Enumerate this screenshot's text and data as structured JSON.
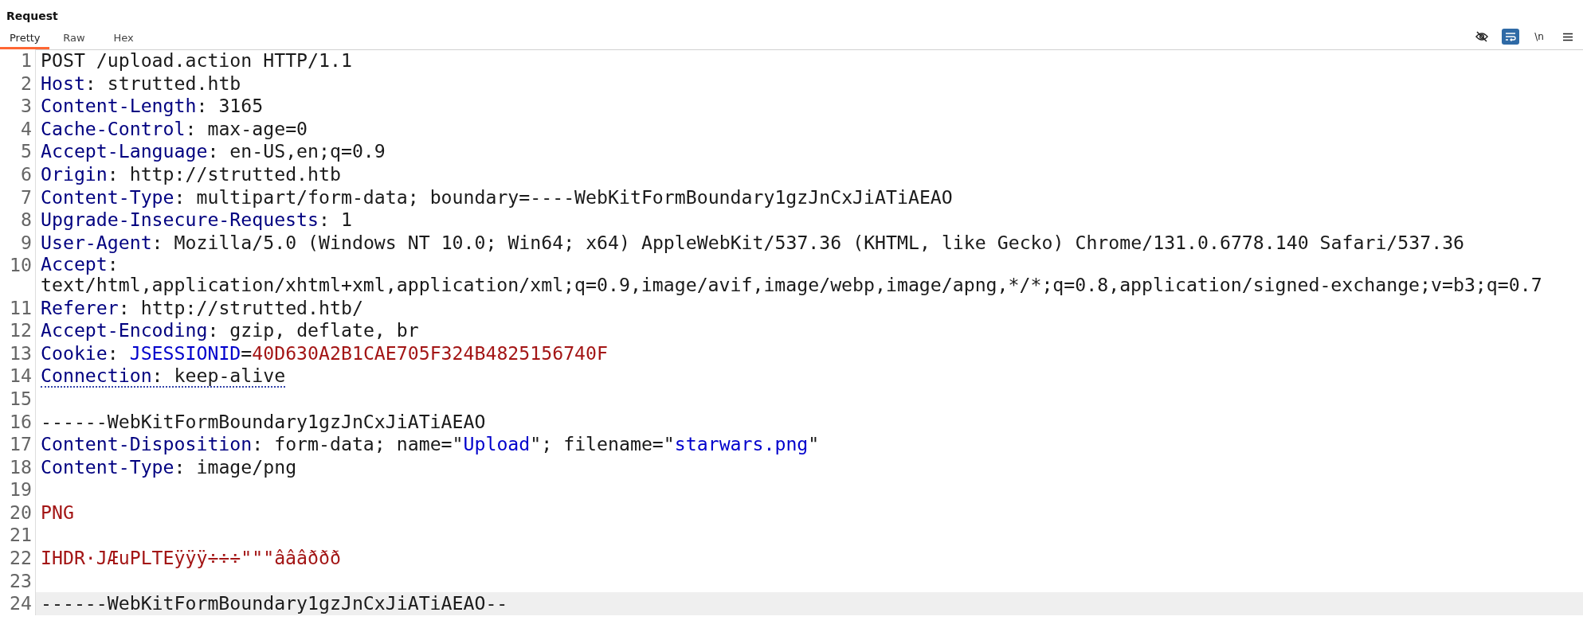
{
  "panel": {
    "title": "Request"
  },
  "tabs": [
    {
      "label": "Pretty",
      "selected": true
    },
    {
      "label": "Raw",
      "selected": false
    },
    {
      "label": "Hex",
      "selected": false
    }
  ],
  "toolbar": [
    {
      "kind": "eye",
      "on": false
    },
    {
      "kind": "wrap",
      "on": true
    },
    {
      "kind": "newline",
      "label": "\\n",
      "on": false
    },
    {
      "kind": "menu",
      "on": false
    }
  ],
  "lines": [
    {
      "number": "1",
      "selected": false,
      "underlined": false,
      "segments": [
        {
          "kind": "plain",
          "text": "POST /upload.action HTTP/1.1"
        }
      ]
    },
    {
      "number": "2",
      "selected": false,
      "underlined": false,
      "segments": [
        {
          "kind": "key",
          "text": "Host"
        },
        {
          "kind": "plain",
          "text": ": strutted.htb"
        }
      ]
    },
    {
      "number": "3",
      "selected": false,
      "underlined": false,
      "segments": [
        {
          "kind": "key",
          "text": "Content-Length"
        },
        {
          "kind": "plain",
          "text": ": 3165"
        }
      ]
    },
    {
      "number": "4",
      "selected": false,
      "underlined": false,
      "segments": [
        {
          "kind": "key",
          "text": "Cache-Control"
        },
        {
          "kind": "plain",
          "text": ": max-age=0"
        }
      ]
    },
    {
      "number": "5",
      "selected": false,
      "underlined": false,
      "segments": [
        {
          "kind": "key",
          "text": "Accept-Language"
        },
        {
          "kind": "plain",
          "text": ": en-US,en;q=0.9"
        }
      ]
    },
    {
      "number": "6",
      "selected": false,
      "underlined": false,
      "segments": [
        {
          "kind": "key",
          "text": "Origin"
        },
        {
          "kind": "plain",
          "text": ": http://strutted.htb"
        }
      ]
    },
    {
      "number": "7",
      "selected": false,
      "underlined": false,
      "segments": [
        {
          "kind": "key",
          "text": "Content-Type"
        },
        {
          "kind": "plain",
          "text": ": multipart/form-data; boundary=----WebKitFormBoundary1gzJnCxJiATiAEAO"
        }
      ]
    },
    {
      "number": "8",
      "selected": false,
      "underlined": false,
      "segments": [
        {
          "kind": "key",
          "text": "Upgrade-Insecure-Requests"
        },
        {
          "kind": "plain",
          "text": ": 1"
        }
      ]
    },
    {
      "number": "9",
      "selected": false,
      "underlined": false,
      "segments": [
        {
          "kind": "key",
          "text": "User-Agent"
        },
        {
          "kind": "plain",
          "text": ": Mozilla/5.0 (Windows NT 10.0; Win64; x64) AppleWebKit/537.36 (KHTML, like Gecko) Chrome/131.0.6778.140 Safari/537.36"
        }
      ]
    },
    {
      "number": "10",
      "selected": false,
      "underlined": false,
      "segments": [
        {
          "kind": "key",
          "text": "Accept"
        },
        {
          "kind": "plain",
          "text": ": text/html,application/xhtml+xml,application/xml;q=0.9,image/avif,image/webp,image/apng,*/*;q=0.8,application/signed-exchange;v=b3;q=0.7"
        }
      ]
    },
    {
      "number": "11",
      "selected": false,
      "underlined": false,
      "segments": [
        {
          "kind": "key",
          "text": "Referer"
        },
        {
          "kind": "plain",
          "text": ": http://strutted.htb/"
        }
      ]
    },
    {
      "number": "12",
      "selected": false,
      "underlined": false,
      "segments": [
        {
          "kind": "key",
          "text": "Accept-Encoding"
        },
        {
          "kind": "plain",
          "text": ": gzip, deflate, br"
        }
      ]
    },
    {
      "number": "13",
      "selected": false,
      "underlined": false,
      "segments": [
        {
          "kind": "key",
          "text": "Cookie"
        },
        {
          "kind": "plain",
          "text": ": "
        },
        {
          "kind": "attr",
          "text": "JSESSIONID"
        },
        {
          "kind": "plain",
          "text": "="
        },
        {
          "kind": "value",
          "text": "40D630A2B1CAE705F324B4825156740F"
        }
      ]
    },
    {
      "number": "14",
      "selected": false,
      "underlined": true,
      "segments": [
        {
          "kind": "key",
          "text": "Connection"
        },
        {
          "kind": "plain",
          "text": ": keep-alive"
        }
      ]
    },
    {
      "number": "15",
      "selected": false,
      "underlined": false
    },
    {
      "number": "16",
      "selected": false,
      "underlined": false,
      "segments": [
        {
          "kind": "plain",
          "text": "------WebKitFormBoundary1gzJnCxJiATiAEAO"
        }
      ]
    },
    {
      "number": "17",
      "selected": false,
      "underlined": false,
      "segments": [
        {
          "kind": "key",
          "text": "Content-Disposition"
        },
        {
          "kind": "plain",
          "text": ": form-data; name=\""
        },
        {
          "kind": "attr",
          "text": "Upload"
        },
        {
          "kind": "plain",
          "text": "\"; filename=\""
        },
        {
          "kind": "attr",
          "text": "starwars.png"
        },
        {
          "kind": "plain",
          "text": "\""
        }
      ]
    },
    {
      "number": "18",
      "selected": false,
      "underlined": false,
      "segments": [
        {
          "kind": "key",
          "text": "Content-Type"
        },
        {
          "kind": "plain",
          "text": ": image/png"
        }
      ]
    },
    {
      "number": "19",
      "selected": false,
      "underlined": false
    },
    {
      "number": "20",
      "selected": false,
      "underlined": false,
      "segments": [
        {
          "kind": "value",
          "text": "PNG"
        }
      ]
    },
    {
      "number": "21",
      "selected": false,
      "underlined": false
    },
    {
      "number": "22",
      "selected": false,
      "underlined": false,
      "segments": [
        {
          "kind": "value",
          "text": "IHDR·JÆuPLTEÿÿÿ÷÷÷\"\"\"âââððð"
        }
      ]
    },
    {
      "number": "23",
      "selected": false,
      "underlined": false
    },
    {
      "number": "24",
      "selected": true,
      "underlined": false,
      "segments": [
        {
          "kind": "plain",
          "text": "------WebKitFormBoundary1gzJnCxJiATiAEAO--"
        }
      ]
    }
  ]
}
